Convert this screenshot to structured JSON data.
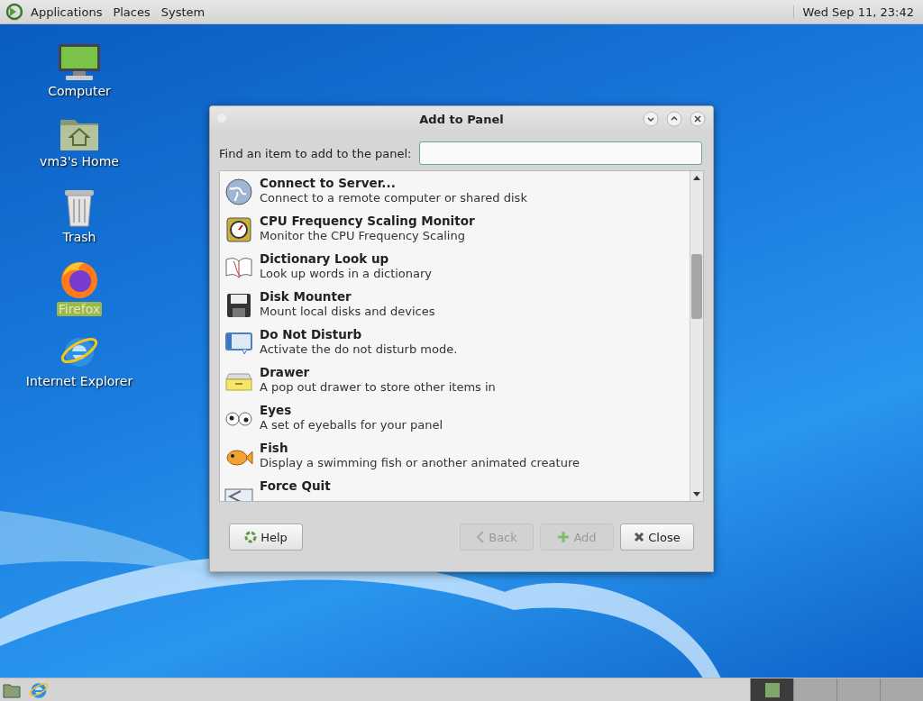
{
  "top_panel": {
    "menus": [
      "Applications",
      "Places",
      "System"
    ],
    "clock": "Wed Sep 11, 23:42"
  },
  "desktop_icons": [
    {
      "kind": "computer",
      "label": "Computer",
      "selected": false
    },
    {
      "kind": "home",
      "label": "vm3's Home",
      "selected": false
    },
    {
      "kind": "trash",
      "label": "Trash",
      "selected": false
    },
    {
      "kind": "firefox",
      "label": "Firefox",
      "selected": true
    },
    {
      "kind": "ie",
      "label": "Internet Explorer",
      "selected": false
    }
  ],
  "dialog": {
    "title": "Add to Panel",
    "find_label": "Find an item to add to the panel:",
    "items": [
      {
        "kind": "globe",
        "name": "Connect to Server...",
        "description": "Connect to a remote computer or shared disk"
      },
      {
        "kind": "cpu",
        "name": "CPU Frequency Scaling Monitor",
        "description": "Monitor the CPU Frequency Scaling"
      },
      {
        "kind": "book",
        "name": "Dictionary Look up",
        "description": "Look up words in a dictionary"
      },
      {
        "kind": "disk",
        "name": "Disk Mounter",
        "description": "Mount local disks and devices"
      },
      {
        "kind": "dnd",
        "name": "Do Not Disturb",
        "description": "Activate the do not disturb mode."
      },
      {
        "kind": "drawer",
        "name": "Drawer",
        "description": "A pop out drawer to store other items in"
      },
      {
        "kind": "eyes",
        "name": "Eyes",
        "description": "A set of eyeballs for your panel"
      },
      {
        "kind": "fish",
        "name": "Fish",
        "description": "Display a swimming fish or another animated creature"
      },
      {
        "kind": "forcequit",
        "name": "Force Quit"
      }
    ],
    "buttons": [
      {
        "kind": "help",
        "label": "Help",
        "disabled": false
      },
      {
        "kind": "back",
        "label": "Back",
        "disabled": true
      },
      {
        "kind": "add",
        "label": "Add",
        "disabled": true
      },
      {
        "kind": "close",
        "label": "Close",
        "disabled": false
      }
    ]
  },
  "bottom_panel": {
    "launchers": [
      {
        "kind": "files"
      },
      {
        "kind": "ie"
      }
    ],
    "workspaces": [
      {
        "selected": true
      },
      {
        "selected": false
      },
      {
        "selected": false
      },
      {
        "selected": false
      }
    ]
  }
}
